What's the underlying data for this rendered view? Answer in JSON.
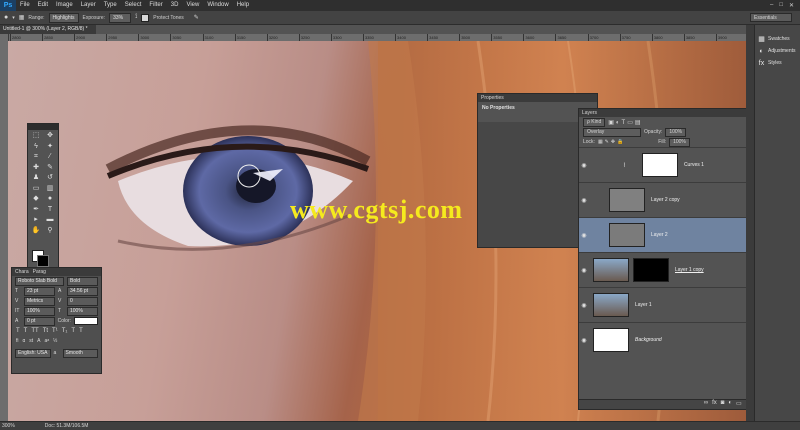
{
  "app": {
    "logo": "Ps",
    "accent": "#31a8ff"
  },
  "menu": [
    "File",
    "Edit",
    "Image",
    "Layer",
    "Type",
    "Select",
    "Filter",
    "3D",
    "View",
    "Window",
    "Help"
  ],
  "options": {
    "range_label": "Range:",
    "range_value": "Highlights",
    "exposure_label": "Exposure:",
    "exposure_value": "33%",
    "protect_tones": "Protect Tones"
  },
  "workspace": "Essentials",
  "doc_tab": "Untitled-1 @ 300% (Layer 2, RGB/8) *",
  "ruler_ticks": [
    "2800",
    "2850",
    "2900",
    "2950",
    "3000",
    "3050",
    "3100",
    "3150",
    "3200",
    "3250",
    "3300",
    "3350",
    "3400",
    "3450",
    "3500",
    "3550",
    "3600",
    "3650",
    "3700",
    "3750",
    "3800",
    "3850",
    "3900"
  ],
  "status": {
    "zoom": "300%",
    "doc": "Doc: 51.3M/106.5M"
  },
  "dock": [
    {
      "label": "Swatches",
      "icon": "grid-icon"
    },
    {
      "label": "Adjustments",
      "icon": "adjustments-icon"
    },
    {
      "label": "Styles",
      "icon": "styles-icon"
    }
  ],
  "properties": {
    "tab": "Properties",
    "empty": "No Properties"
  },
  "layers_panel": {
    "tab": "Layers",
    "kind": "ρ Kind",
    "blend": "Overlay",
    "opacity_label": "Opacity:",
    "opacity": "100%",
    "lock_label": "Lock:",
    "fill_label": "Fill:",
    "fill": "100%",
    "layers": [
      {
        "name": "Curves 1",
        "thumb": "#ffffff",
        "selected": false
      },
      {
        "name": "Layer 2 copy",
        "thumb": "#808080",
        "selected": false
      },
      {
        "name": "Layer 2",
        "thumb": "#7b7b7b",
        "selected": true
      },
      {
        "name": "Layer 1 copy",
        "thumb": "#6a86a8",
        "selected": false
      },
      {
        "name": "Layer 1",
        "thumb": "#6a86a8",
        "selected": false
      },
      {
        "name": "Background",
        "thumb": "#ffffff",
        "selected": false
      }
    ]
  },
  "character": {
    "tabs": [
      "Chara",
      "Parag"
    ],
    "font": "Roboto Slab Bold",
    "style": "Bold",
    "size": "23 pt",
    "leading": "34.56 pt",
    "kerning": "Metrics",
    "tracking": "0",
    "vscale": "100%",
    "hscale": "100%",
    "baseline": "0 pt",
    "color_label": "Color:",
    "language": "English: USA",
    "aa": "Smooth"
  },
  "watermark": "www.cgtsj.com"
}
